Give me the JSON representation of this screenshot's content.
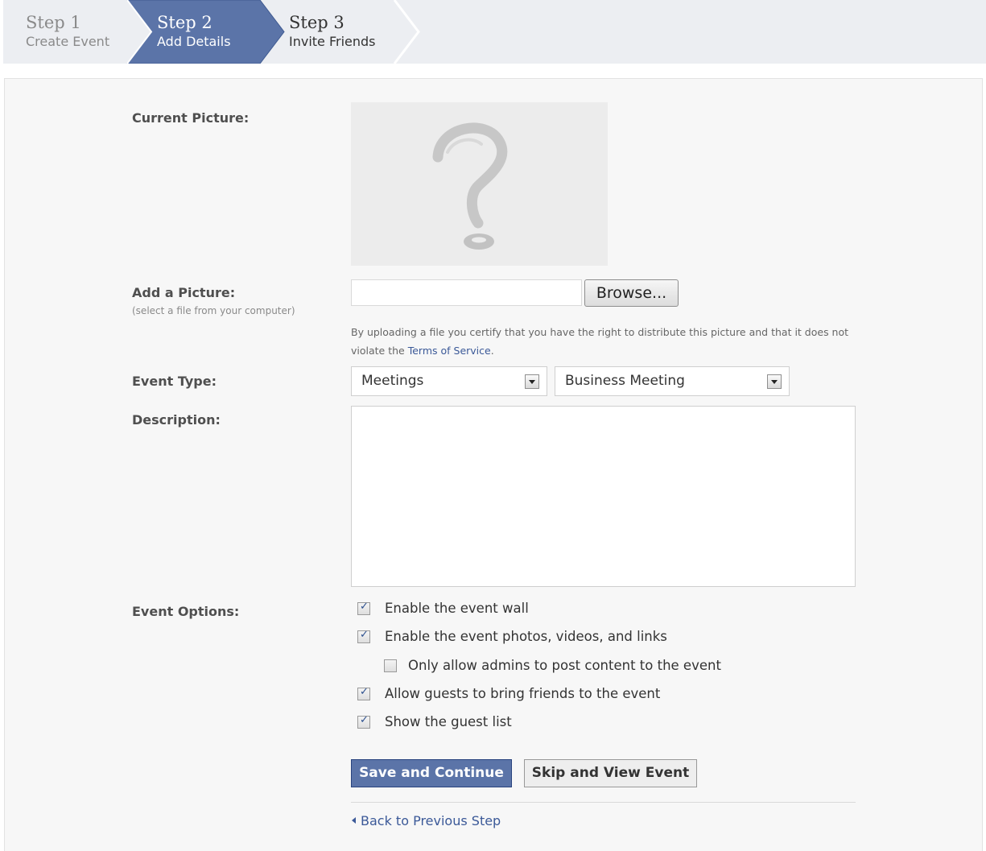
{
  "steps": [
    {
      "number": "Step 1",
      "label": "Create Event",
      "state": "done"
    },
    {
      "number": "Step 2",
      "label": "Add Details",
      "state": "active"
    },
    {
      "number": "Step 3",
      "label": "Invite Friends",
      "state": "upcoming"
    }
  ],
  "colors": {
    "active_step": "#5b74a8",
    "link": "#3b5998",
    "primary_button": "#5b74a8",
    "panel_bg": "#f7f7f7"
  },
  "form": {
    "current_picture_label": "Current Picture:",
    "placeholder_icon": "question-mark-icon",
    "add_picture_label": "Add a Picture:",
    "add_picture_hint": "(select a file from your computer)",
    "file_value": "",
    "browse_label": "Browse...",
    "disclaimer_text": "By uploading a file you certify that you have the right to distribute this picture and that it does not violate the ",
    "terms_link": "Terms of Service",
    "disclaimer_end": ".",
    "event_type_label": "Event Type:",
    "event_type_value": "Meetings",
    "event_subtype_value": "Business Meeting",
    "description_label": "Description:",
    "description_value": "",
    "event_options_label": "Event Options:",
    "options": [
      {
        "label": "Enable the event wall",
        "checked": true
      },
      {
        "label": "Enable the event photos, videos, and links",
        "checked": true
      },
      {
        "label": "Only allow admins to post content to the event",
        "checked": false
      },
      {
        "label": "Allow guests to bring friends to the event",
        "checked": true
      },
      {
        "label": "Show the guest list",
        "checked": true
      }
    ]
  },
  "actions": {
    "save_label": "Save and Continue",
    "skip_label": "Skip and View Event",
    "back_label": "Back to Previous Step"
  }
}
